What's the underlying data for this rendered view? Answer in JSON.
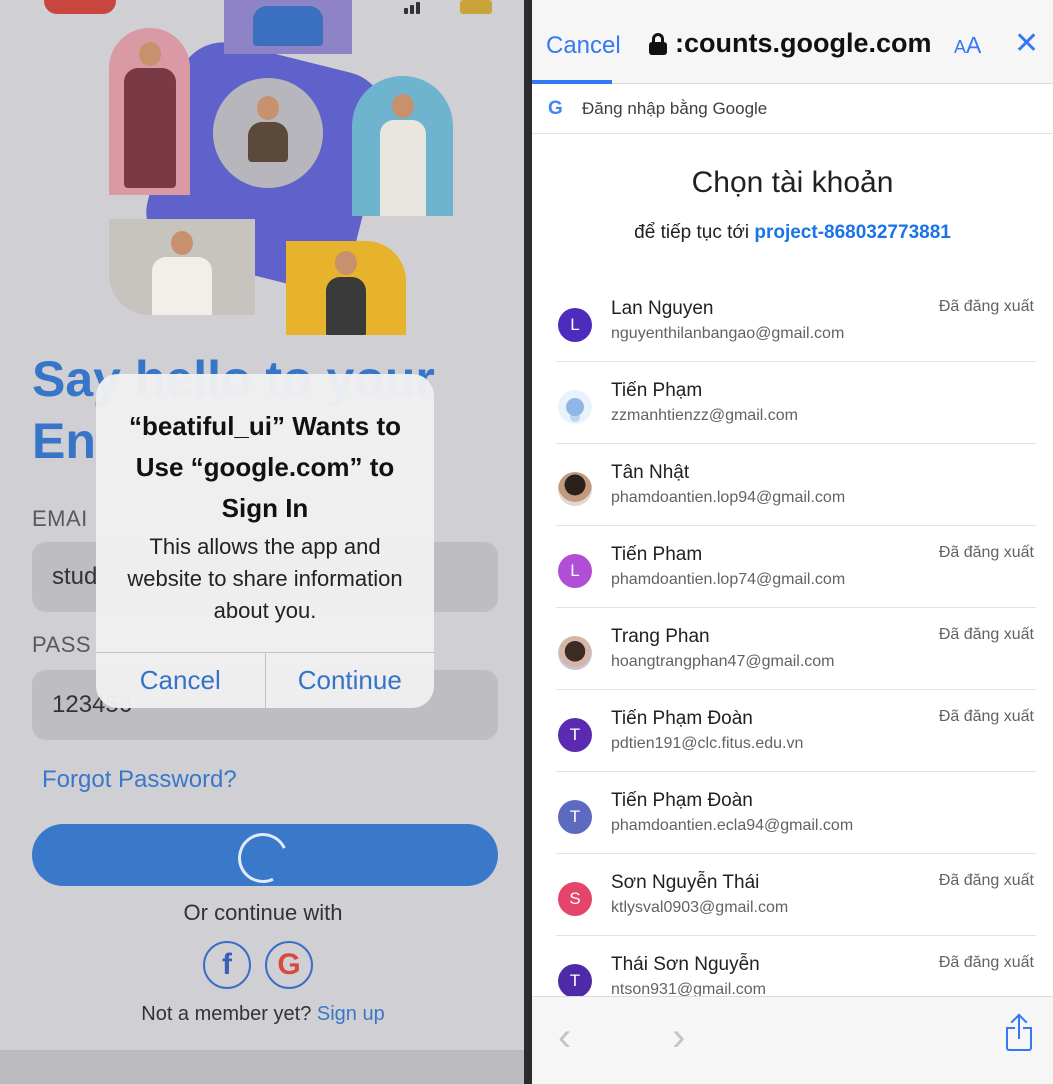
{
  "left": {
    "hero_title": "Say hello to your En",
    "email_label": "EMAI",
    "email_value": "stud",
    "password_label": "PASS",
    "password_value": "123456",
    "forgot_password": "Forgot Password?",
    "or_continue": "Or continue with",
    "facebook_glyph": "f",
    "google_glyph": "G",
    "not_member": "Not a member yet?",
    "sign_up": "Sign up",
    "dialog": {
      "title": "“beatiful_ui” Wants to Use “google.com” to Sign In",
      "message": "This allows the app and website to share information about you.",
      "cancel": "Cancel",
      "continue": "Continue"
    }
  },
  "right": {
    "toolbar": {
      "cancel": "Cancel",
      "url": ":counts.google.com",
      "aa_small": "A",
      "aa_large": "A",
      "close": "✕"
    },
    "google_bar": {
      "icon": "G",
      "label": "Đăng nhập bằng Google"
    },
    "title": "Chọn tài khoản",
    "subtitle_prefix": "để tiếp tục tới",
    "project": "project-868032773881",
    "accounts": [
      {
        "name": "Lan Nguyen",
        "email": "nguyenthilanbangao@gmail.com",
        "status": "Đã đăng xuất",
        "avatar_letter": "L",
        "avatar_color": "#4d2bbd"
      },
      {
        "name": "Tiến Phạm",
        "email": "zzmanhtienzz@gmail.com",
        "status": "",
        "avatar_letter": "",
        "avatar_color": ""
      },
      {
        "name": "Tân Nhật",
        "email": "phamdoantien.lop94@gmail.com",
        "status": "",
        "avatar_letter": "",
        "avatar_color": ""
      },
      {
        "name": "Tiến Pham",
        "email": "phamdoantien.lop74@gmail.com",
        "status": "Đã đăng xuất",
        "avatar_letter": "L",
        "avatar_color": "#b04fd6"
      },
      {
        "name": "Trang Phan",
        "email": "hoangtrangphan47@gmail.com",
        "status": "Đã đăng xuất",
        "avatar_letter": "",
        "avatar_color": ""
      },
      {
        "name": "Tiến Phạm Đoàn",
        "email": "pdtien191@clc.fitus.edu.vn",
        "status": "Đã đăng xuất",
        "avatar_letter": "T",
        "avatar_color": "#5a2ab0"
      },
      {
        "name": "Tiến Phạm Đoàn",
        "email": "phamdoantien.ecla94@gmail.com",
        "status": "",
        "avatar_letter": "T",
        "avatar_color": "#5c6bc0"
      },
      {
        "name": "Sơn Nguyễn Thái",
        "email": "ktlysval0903@gmail.com",
        "status": "Đã đăng xuất",
        "avatar_letter": "S",
        "avatar_color": "#e3456b"
      },
      {
        "name": "Thái Sơn Nguyễn",
        "email": "ntson931@gmail.com",
        "status": "Đã đăng xuất",
        "avatar_letter": "T",
        "avatar_color": "#4e2aa8"
      }
    ],
    "nav": {
      "back": "‹",
      "forward": "›"
    }
  }
}
